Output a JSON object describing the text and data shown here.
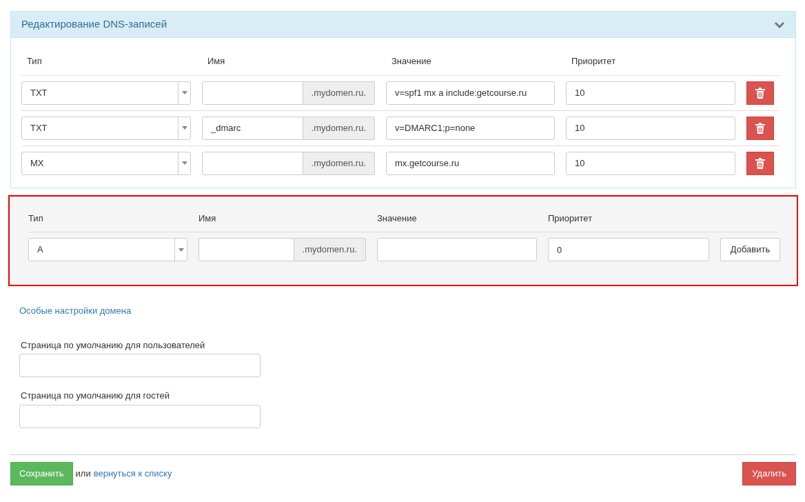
{
  "panel": {
    "title": "Редактирование DNS-записей",
    "expanded": true
  },
  "records": {
    "columns": [
      "Тип",
      "Имя",
      "Значение",
      "Приоритет"
    ],
    "rows": [
      {
        "type": "TXT",
        "name": "",
        "suffix": ".mydomen.ru.",
        "value": "v=spf1 mx a include:getcourse.ru",
        "priority": "10"
      },
      {
        "type": "TXT",
        "name": "_dmarc",
        "suffix": ".mydomen.ru.",
        "value": "v=DMARC1;p=none",
        "priority": "10"
      },
      {
        "type": "MX",
        "name": "",
        "suffix": ".mydomen.ru.",
        "value": "mx.getcourse.ru",
        "priority": "10"
      }
    ]
  },
  "new_record": {
    "highlighted": true,
    "columns": [
      "Тип",
      "Имя",
      "Значение",
      "Приоритет"
    ],
    "type": "A",
    "suffix": ".mydomen.ru.",
    "priority": "0",
    "add_button": "Добавить"
  },
  "special_settings_link": "Особые настройки домена",
  "fields": [
    {
      "label": "Страница по умолчанию для пользователей"
    },
    {
      "label": "Страница по умолчанию для гостей"
    }
  ],
  "footer": {
    "save_button": "Сохранить",
    "or_text": "или",
    "back_link": "вернуться к списку",
    "delete_button": "Удалить"
  }
}
